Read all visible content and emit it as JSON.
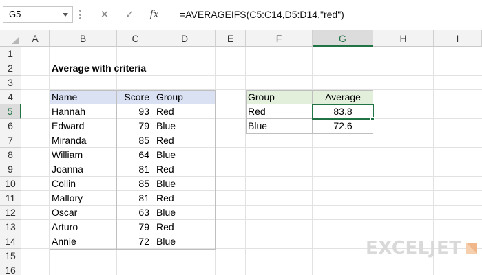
{
  "formula_bar": {
    "name_box": "G5",
    "cancel_icon": "✕",
    "enter_icon": "✓",
    "fx_label": "fx",
    "formula": "=AVERAGEIFS(C5:C14,D5:D14,\"red\")"
  },
  "columns": [
    "A",
    "B",
    "C",
    "D",
    "E",
    "F",
    "G",
    "H",
    "I"
  ],
  "rows": [
    "1",
    "2",
    "3",
    "4",
    "5",
    "6",
    "7",
    "8",
    "9",
    "10",
    "11",
    "12",
    "13",
    "14",
    "15",
    "16"
  ],
  "title": "Average with criteria",
  "data_table": {
    "headers": [
      "Name",
      "Score",
      "Group"
    ],
    "rows": [
      [
        "Hannah",
        "93",
        "Red"
      ],
      [
        "Edward",
        "79",
        "Blue"
      ],
      [
        "Miranda",
        "85",
        "Red"
      ],
      [
        "William",
        "64",
        "Blue"
      ],
      [
        "Joanna",
        "81",
        "Red"
      ],
      [
        "Collin",
        "85",
        "Blue"
      ],
      [
        "Mallory",
        "81",
        "Red"
      ],
      [
        "Oscar",
        "63",
        "Blue"
      ],
      [
        "Arturo",
        "79",
        "Red"
      ],
      [
        "Annie",
        "72",
        "Blue"
      ]
    ]
  },
  "summary_table": {
    "headers": [
      "Group",
      "Average"
    ],
    "rows": [
      [
        "Red",
        "83.8"
      ],
      [
        "Blue",
        "72.6"
      ]
    ]
  },
  "logo": {
    "text": "EXCELJET"
  },
  "colors": {
    "header_blue": "#d9e1f2",
    "header_green": "#e2efda",
    "selection": "#217346",
    "logo_orange": "#f0b88a"
  }
}
